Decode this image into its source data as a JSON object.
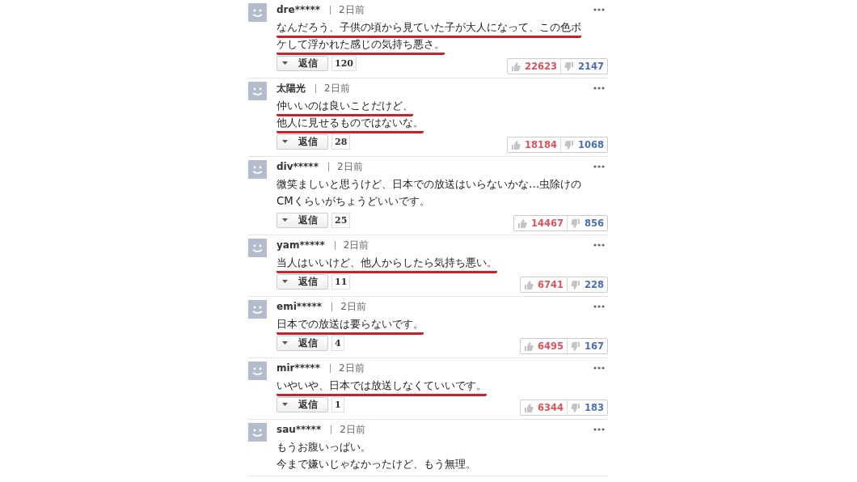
{
  "comments": [
    {
      "user": "dre*****",
      "time": "2日前",
      "lines": [
        {
          "text": "なんだろう、子供の頃から見ていた子が大人になって、この色ボ",
          "underlined": true
        },
        {
          "text": "ケして浮かれた感じの気持ち悪さ。",
          "underlined": true
        }
      ],
      "reply_label": "返信",
      "reply_count": "120",
      "likes": "22623",
      "dislikes": "2147"
    },
    {
      "user": "太陽光",
      "time": "2日前",
      "lines": [
        {
          "text": "仲いいのは良いことだけど、",
          "underlined": true
        },
        {
          "text": "他人に見せるものではないな。",
          "underlined": true
        }
      ],
      "reply_label": "返信",
      "reply_count": "28",
      "likes": "18184",
      "dislikes": "1068"
    },
    {
      "user": "div*****",
      "time": "2日前",
      "lines": [
        {
          "text": "微笑ましいと思うけど、日本での放送はいらないかな…虫除けの",
          "underlined": false
        },
        {
          "text": "CMくらいがちょうどいいです。",
          "underlined": false
        }
      ],
      "reply_label": "返信",
      "reply_count": "25",
      "likes": "14467",
      "dislikes": "856"
    },
    {
      "user": "yam*****",
      "time": "2日前",
      "lines": [
        {
          "text": "当人はいいけど、他人からしたら気持ち悪い。",
          "underlined": true
        }
      ],
      "reply_label": "返信",
      "reply_count": "11",
      "likes": "6741",
      "dislikes": "228"
    },
    {
      "user": "emi*****",
      "time": "2日前",
      "lines": [
        {
          "text": "日本での放送は要らないです。",
          "underlined": true
        }
      ],
      "reply_label": "返信",
      "reply_count": "4",
      "likes": "6495",
      "dislikes": "167"
    },
    {
      "user": "mir*****",
      "time": "2日前",
      "lines": [
        {
          "text": "いやいや、日本では放送しなくていいです。",
          "underlined": true
        }
      ],
      "reply_label": "返信",
      "reply_count": "1",
      "likes": "6344",
      "dislikes": "183"
    },
    {
      "user": "sau*****",
      "time": "2日前",
      "lines": [
        {
          "text": "もうお腹いっぱい。",
          "underlined": false
        },
        {
          "text": "今まで嫌いじゃなかったけど、もう無理。",
          "underlined": false
        }
      ]
    }
  ]
}
